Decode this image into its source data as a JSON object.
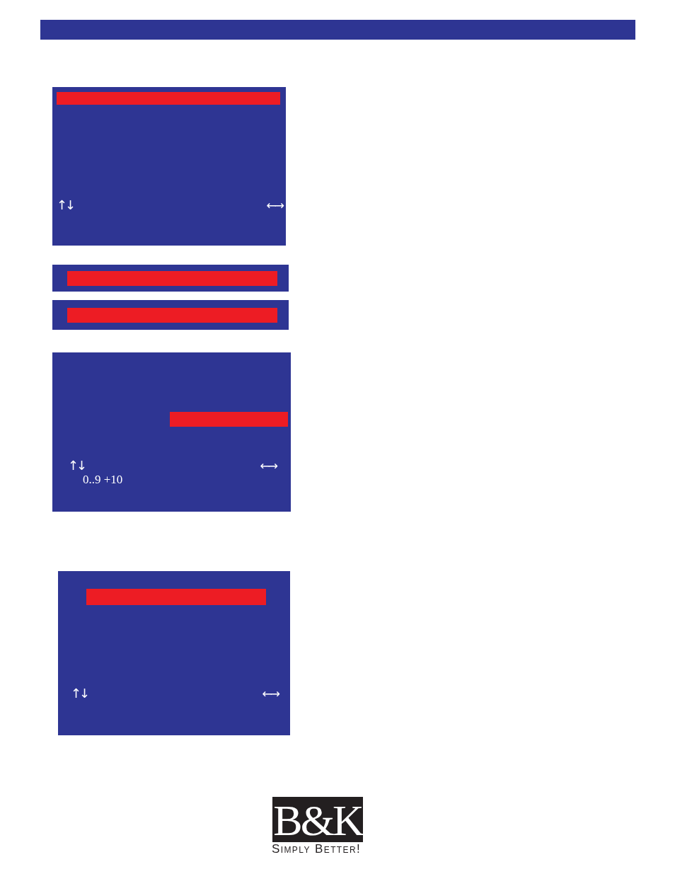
{
  "screens": [
    {
      "kind": "menu",
      "nav_keys": "↑↓",
      "adjust_keys": "←→"
    },
    {
      "kind": "strip"
    },
    {
      "kind": "strip"
    },
    {
      "kind": "entry",
      "nav_keys": "↑↓",
      "adjust_keys": "←→",
      "hint": "0..9 +10"
    },
    {
      "kind": "setup",
      "nav_keys": "↑↓",
      "adjust_keys": "←→"
    }
  ],
  "logo": {
    "mark": "B&K",
    "tagline": "Simply Better!"
  }
}
